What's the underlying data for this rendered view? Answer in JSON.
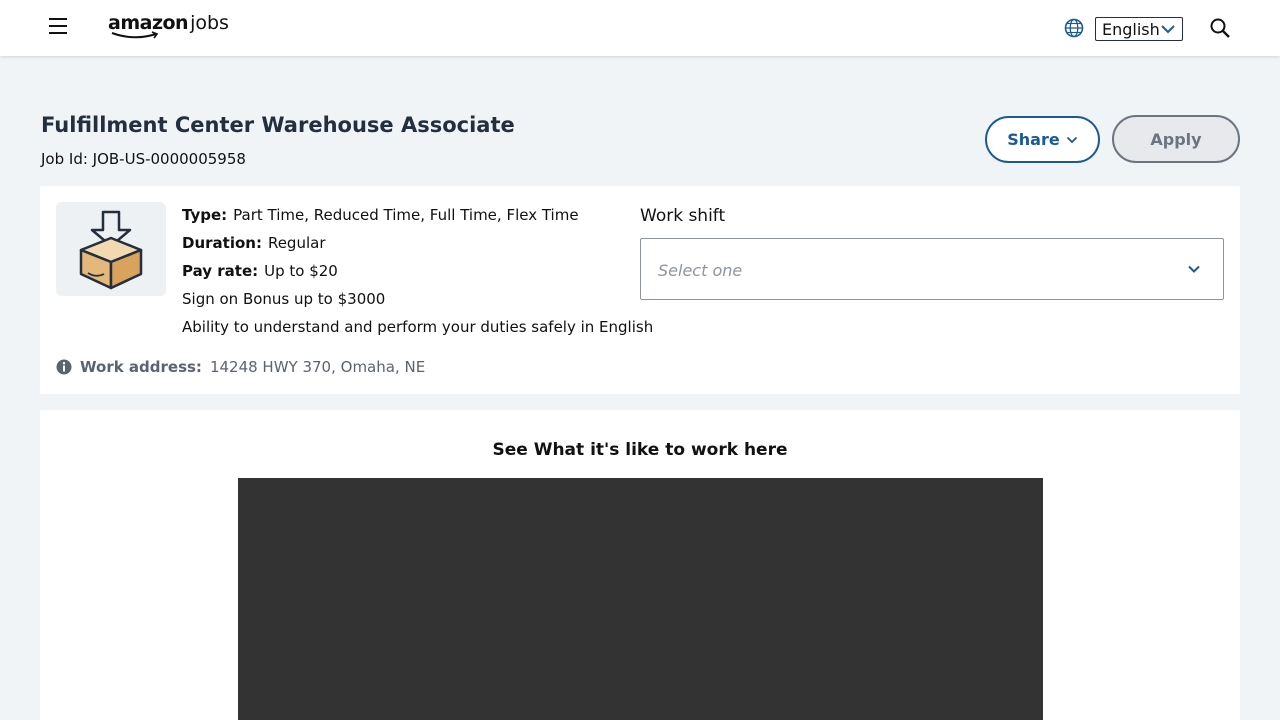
{
  "header": {
    "logo_amazon": "amazon",
    "logo_jobs": "jobs",
    "language": {
      "selected": "English"
    },
    "icons": [
      "menu-icon",
      "globe-icon",
      "chevron-down-icon",
      "search-icon"
    ]
  },
  "job": {
    "title": "Fulfillment Center Warehouse Associate",
    "job_id": "Job Id: JOB-US-0000005958",
    "share_label": "Share",
    "apply_label": "Apply",
    "type_label": "Type:",
    "type_value": "Part Time, Reduced Time, Full Time, Flex Time",
    "duration_label": "Duration:",
    "duration_value": "Regular",
    "pay_label": "Pay rate:",
    "pay_value": "Up to $20",
    "bonus": "Sign on Bonus up to $3000",
    "requirement": "Ability to understand and perform your duties safely in English",
    "work_shift_label": "Work shift",
    "work_shift_placeholder": "Select one",
    "address_label": "Work address:",
    "address_value": "14248 HWY 370, Omaha, NE"
  },
  "video": {
    "heading": "See What it's like to work here"
  },
  "colors": {
    "page_bg": "#f1f4f7",
    "brand_blue": "#1a5a96",
    "disabled_gray": "#6b7580",
    "video_bg": "#333333"
  }
}
